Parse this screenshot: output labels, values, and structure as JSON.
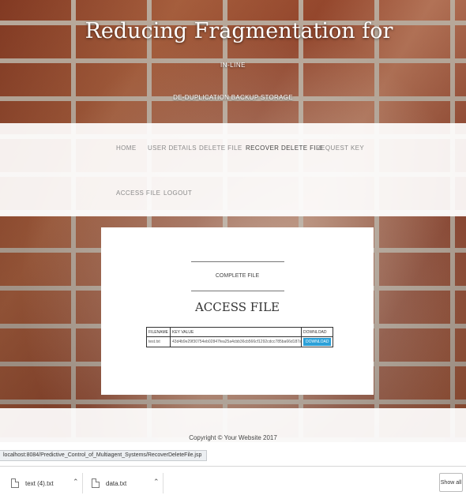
{
  "header": {
    "title": "Reducing Fragmentation for",
    "line2": "IN-LINE",
    "line3": "DE-DUPLICATION BACKUP STORAGE"
  },
  "nav": {
    "items": [
      {
        "label": "HOME"
      },
      {
        "label": "USER DETAILS"
      },
      {
        "label": "DELETE FILE"
      },
      {
        "label": "RECOVER DELETE FILE"
      },
      {
        "label": "REQUEST KEY"
      },
      {
        "label": "ACCESS FILE"
      },
      {
        "label": "LOGOUT"
      }
    ]
  },
  "panel": {
    "complete_label": "COMPLETE FILE",
    "title": "ACCESS FILE",
    "table": {
      "headers": [
        "FILENAME",
        "KEY VALUE",
        "DOWNLOAD"
      ],
      "rows": [
        {
          "filename": "test.txt",
          "key_value": "43d4b9e29f30754eb02847fea25a4cbb36cb566cf1292cdcc785ba66d187a",
          "download_label": "DOWNLOAD"
        }
      ]
    }
  },
  "footer": {
    "copyright": "Copyright © Your Website 2017"
  },
  "status_bar": {
    "url": "localhost:8084/Predictive_Control_of_Multiagent_Systems/RecoverDeleteFile.jsp"
  },
  "downloads": {
    "items": [
      {
        "name": "text (4).txt"
      },
      {
        "name": "data.txt"
      }
    ],
    "show_all": "Show all"
  },
  "colors": {
    "download_button": "#2ba0d8",
    "brick": "#b5633f"
  }
}
